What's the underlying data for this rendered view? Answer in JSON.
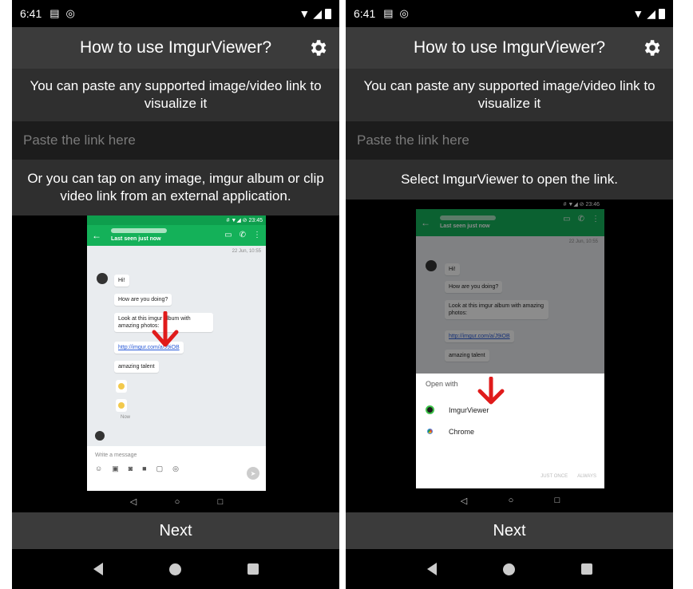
{
  "left": {
    "status": {
      "time": "6:41"
    },
    "title": "How to use ImgurViewer?",
    "intro": "You can paste any supported image/video link to visualize it",
    "input_placeholder": "Paste the link here",
    "instruction": "Or you can tap on any image, imgur album or clip video link from an external application.",
    "next_label": "Next",
    "mini": {
      "time": "# ▼◢ ⊘ 23:45",
      "subtitle": "Last seen just now",
      "date": "22 Jun, 10:55",
      "messages": [
        "Hi!",
        "How are you doing?",
        "Look at this imgur album with amazing photos:",
        "http://imgur.com/a/J9iOB",
        "amazing talent"
      ],
      "now": "Now",
      "compose_placeholder": "Write a message",
      "accent": "#14b159"
    }
  },
  "right": {
    "status": {
      "time": "6:41"
    },
    "title": "How to use ImgurViewer?",
    "intro": "You can paste any supported image/video link to visualize it",
    "input_placeholder": "Paste the link here",
    "instruction": "Select ImgurViewer to open the link.",
    "next_label": "Next",
    "mini": {
      "time": "# ▼◢ ⊘ 23:46",
      "subtitle": "Last seen just now",
      "date": "22 Jun, 10:55",
      "messages": [
        "Hi!",
        "How are you doing?",
        "Look at this imgur album with amazing photos:",
        "http://imgur.com/a/J9iOB",
        "amazing talent"
      ],
      "open_with": "Open with",
      "apps": [
        "ImgurViewer",
        "Chrome"
      ],
      "just_once": "JUST ONCE",
      "always": "ALWAYS"
    }
  },
  "colors": {
    "arrow": "#e01b1b",
    "appbar": "#3b3b3b"
  }
}
